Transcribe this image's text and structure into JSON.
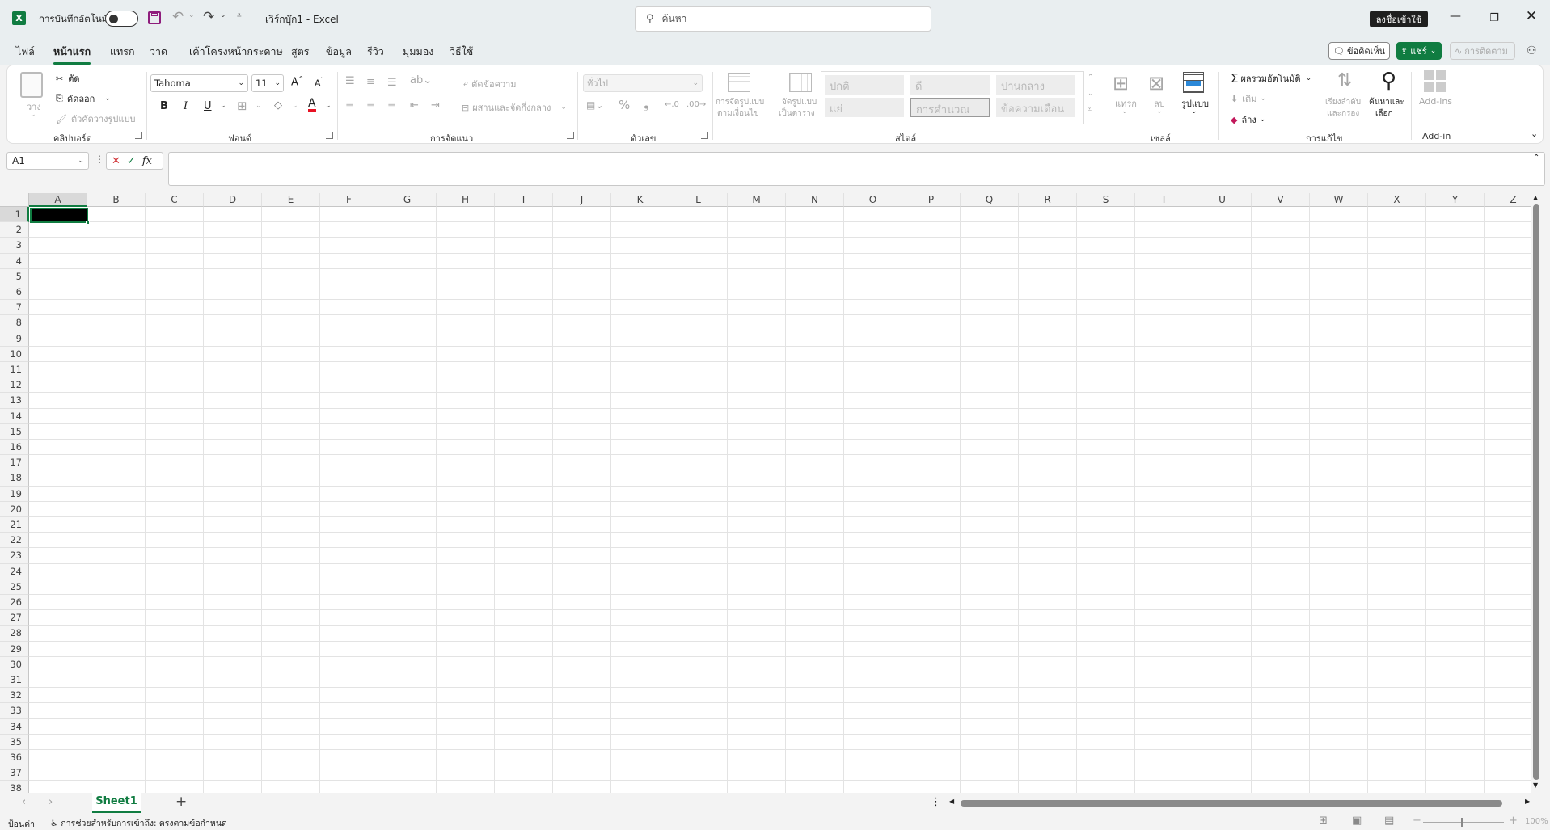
{
  "titlebar": {
    "autosave_label": "การบันทึกอัตโนมัติ",
    "title": "เวิร์กบุ๊ก1  -  Excel",
    "search_placeholder": "ค้นหา",
    "signin_label": "ลงชื่อเข้าใช้"
  },
  "tabs": [
    "ไฟล์",
    "หน้าแรก",
    "แทรก",
    "วาด",
    "เค้าโครงหน้ากระดาษ",
    "สูตร",
    "ข้อมูล",
    "รีวิว",
    "มุมมอง",
    "วิธีใช้"
  ],
  "actions": {
    "comments": "ข้อคิดเห็น",
    "share": "แชร์",
    "catchup": "การติดตาม"
  },
  "ribbon": {
    "clipboard": {
      "paste": "วาง",
      "cut": "ตัด",
      "copy": "คัดลอก",
      "format_painter": "ตัวคัดวางรูปแบบ",
      "group": "คลิปบอร์ด"
    },
    "font": {
      "name": "Tahoma",
      "size": "11",
      "bold": "B",
      "italic": "I",
      "underline": "U",
      "group": "ฟอนต์"
    },
    "alignment": {
      "wrap": "ตัดข้อความ",
      "merge": "ผสานและจัดกึ่งกลาง",
      "group": "การจัดแนว"
    },
    "number": {
      "format": "ทั่วไป",
      "group": "ตัวเลข"
    },
    "styles": {
      "conditional_line1": "การจัดรูปแบบ",
      "conditional_line2": "ตามเงื่อนไข",
      "table_line1": "จัดรูปแบบ",
      "table_line2": "เป็นตาราง",
      "cells": [
        "ปกติ",
        "ดี",
        "ปานกลาง",
        "แย่",
        "การคำนวณ",
        "ข้อความเตือน"
      ],
      "group": "สไตล์"
    },
    "cells": {
      "insert": "แทรก",
      "delete": "ลบ",
      "format": "รูปแบบ",
      "group": "เซลล์"
    },
    "editing": {
      "autosum": "ผลรวมอัตโนมัติ",
      "fill": "เติม",
      "clear": "ล้าง",
      "sort_line1": "เรียงลำดับ",
      "sort_line2": "และกรอง",
      "find_line1": "ค้นหาและ",
      "find_line2": "เลือก",
      "group": "การแก้ไข"
    },
    "addins": {
      "label": "Add-ins",
      "group": "Add-in"
    }
  },
  "formula": {
    "namebox": "A1",
    "fx": "fx",
    "value": ""
  },
  "grid": {
    "columns": [
      "A",
      "B",
      "C",
      "D",
      "E",
      "F",
      "G",
      "H",
      "I",
      "J",
      "K",
      "L",
      "M",
      "N",
      "O",
      "P",
      "Q",
      "R",
      "S",
      "T",
      "U",
      "V",
      "W",
      "X",
      "Y",
      "Z"
    ],
    "rows": [
      "1",
      "2",
      "3",
      "4",
      "5",
      "6",
      "7",
      "8",
      "9",
      "10",
      "11",
      "12",
      "13",
      "14",
      "15",
      "16",
      "17",
      "18",
      "19",
      "20",
      "21",
      "22",
      "23",
      "24",
      "25",
      "26",
      "27",
      "28",
      "29",
      "30",
      "31",
      "32",
      "33",
      "34",
      "35",
      "36",
      "37",
      "38"
    ],
    "selected": "A1"
  },
  "sheets": {
    "tabs": [
      "Sheet1"
    ]
  },
  "status": {
    "mode": "ป้อนค่า",
    "accessibility": "การช่วยสำหรับการเข้าถึง: ตรงตามข้อกำหนด",
    "zoom": "100%"
  },
  "colors": {
    "accent": "#107c41",
    "font_red": "#e81123"
  }
}
